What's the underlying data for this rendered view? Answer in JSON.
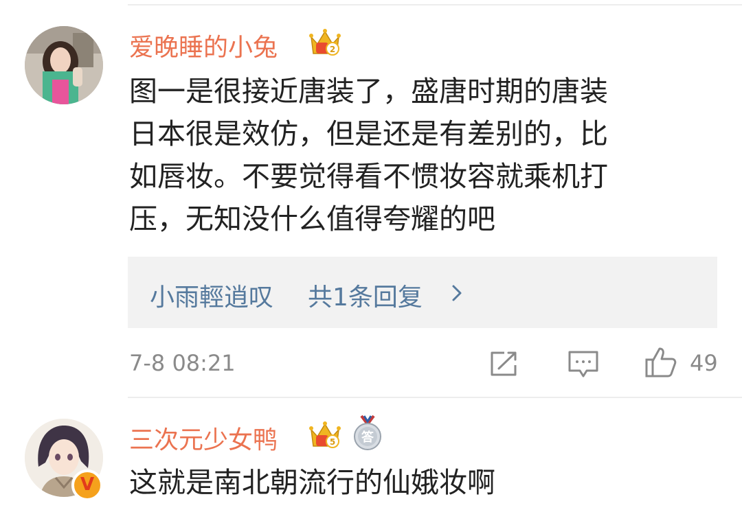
{
  "comments": [
    {
      "username": "爱晚睡的小兔",
      "crown_level": "2",
      "text_lines": [
        "图一是很接近唐装了，盛唐时期的唐装",
        "日本很是效仿，但是还是有差别的，比",
        "如唇妆。不要觉得看不惯妆容就乘机打",
        "压，无知没什么值得夸耀的吧"
      ],
      "reply": {
        "author": "小雨輕逍叹",
        "count_label": "共1条回复"
      },
      "timestamp": "7-8 08:21",
      "likes": "49"
    },
    {
      "username": "三次元少女鸭",
      "crown_level": "5",
      "medal_label": "答",
      "verified_mark": "V",
      "text": "这就是南北朝流行的仙娥妆啊"
    }
  ],
  "icons": {
    "reply_chevron": "chevron-right-icon",
    "share": "share-icon",
    "comment": "comment-icon",
    "like": "thumbs-up-icon"
  },
  "colors": {
    "username": "#eb7350",
    "reply_link": "#55799d",
    "meta_text": "#8a8a8a",
    "reply_bg": "#f2f2f2",
    "crown_gold": "#f0b521",
    "crown_red": "#e94b2f"
  }
}
